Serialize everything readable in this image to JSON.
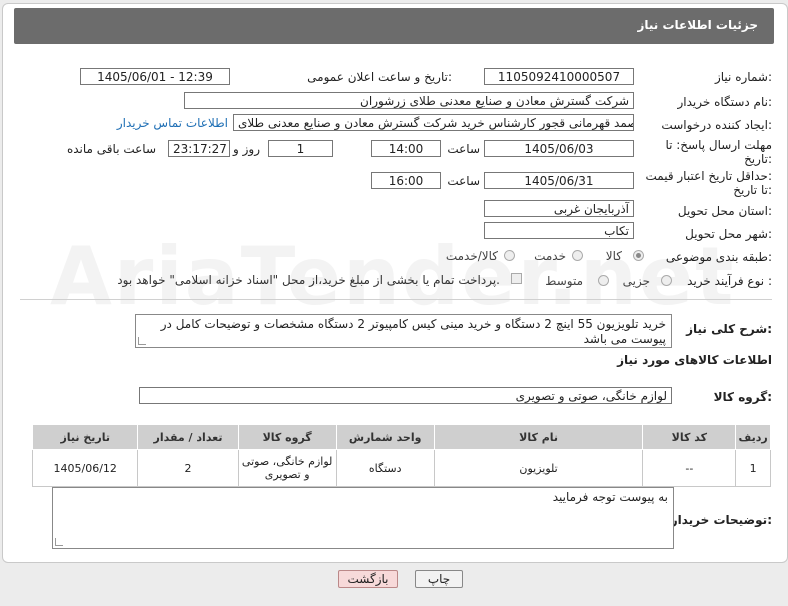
{
  "page_title": "جزئیات اطلاعات نیاز",
  "watermark": "AriaTender.net",
  "fields": {
    "need_number_label": "شماره نیاز:",
    "need_number": "1105092410000507",
    "announce_label": "تاریخ و ساعت اعلان عمومی:",
    "announce_value": "1405/06/01 - 12:39",
    "buyer_org_label": "نام دستگاه خریدار:",
    "buyer_org": "شرکت گسترش معادن و صنایع معدنی طلای زرشوران",
    "requester_label": "ایجاد کننده درخواست:",
    "requester": "صمد قهرمانی قجور کارشناس خرید شرکت گسترش معادن و صنایع معدنی طلای",
    "contact_link": "اطلاعات تماس خریدار",
    "deadline_label_1": "مهلت ارسال پاسخ: تا",
    "deadline_label_2": "تاریخ:",
    "deadline_date": "1405/06/03",
    "time_label": "ساعت",
    "deadline_time": "14:00",
    "days_value": "1",
    "days_label": "روز و",
    "remaining_value": "23:17:27",
    "remaining_label": "ساعت باقی مانده",
    "min_date_label_1": "حداقل تاریخ اعتبار قیمت:",
    "min_date_label_2": "تا تاریخ:",
    "min_date": "1405/06/31",
    "min_time": "16:00",
    "province_label": "استان محل تحویل:",
    "province": "آذربایجان غربی",
    "city_label": "شهر محل تحویل:",
    "city": "تکاب",
    "category_label": "طبقه بندی موضوعی:",
    "category_options": [
      "کالا",
      "خدمت",
      "کالا/خدمت"
    ],
    "process_label": "نوع فرآیند خرید :",
    "process_options": [
      "جزیی",
      "متوسط"
    ],
    "payment_note": "پرداخت تمام یا بخشی از مبلغ خرید،از محل \"اسناد خزانه اسلامی\" خواهد بود."
  },
  "description": {
    "label": "شرح کلی نیاز:",
    "text": "خرید تلویزیون 55 اینچ 2 دستگاه و خرید مینی کیس کامپیوتر 2 دستگاه مشخصات و توضیحات کامل در پیوست می باشد"
  },
  "goods_section_title": "اطلاعات کالاهای مورد نیاز",
  "goods_group": {
    "label": "گروه کالا:",
    "value": "لوازم خانگی، صوتی و تصویری"
  },
  "table": {
    "headers": [
      "ردیف",
      "کد کالا",
      "نام کالا",
      "واحد شمارش",
      "گروه کالا",
      "تعداد / مقدار",
      "تاریخ نیاز"
    ],
    "rows": [
      [
        "1",
        "--",
        "تلویزیون",
        "دستگاه",
        "لوازم خانگی، صوتی و تصویری",
        "2",
        "1405/06/12"
      ]
    ]
  },
  "buyer_notes": {
    "label": "توضیحات خریدار:",
    "text": "به پیوست توجه فرمایید"
  },
  "buttons": {
    "print": "چاپ",
    "back": "بازگشت"
  }
}
